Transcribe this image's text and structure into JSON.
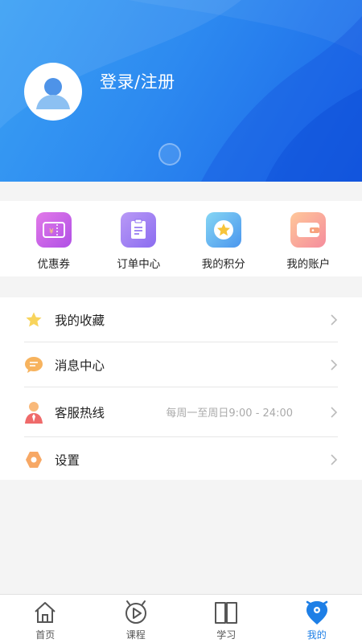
{
  "header": {
    "login_label": "登录/注册"
  },
  "quick_actions": [
    {
      "label": "优惠券",
      "icon": "coupon-icon"
    },
    {
      "label": "订单中心",
      "icon": "order-icon"
    },
    {
      "label": "我的积分",
      "icon": "star-points-icon"
    },
    {
      "label": "我的账户",
      "icon": "wallet-icon"
    }
  ],
  "menu": [
    {
      "label": "我的收藏",
      "icon": "star-icon"
    },
    {
      "label": "消息中心",
      "icon": "message-icon"
    },
    {
      "label": "客服热线",
      "icon": "customer-service-icon",
      "subtext": "每周一至周日9:00 - 24:00"
    },
    {
      "label": "设置",
      "icon": "settings-icon"
    }
  ],
  "tabbar": [
    {
      "label": "首页",
      "icon": "home-icon"
    },
    {
      "label": "课程",
      "icon": "play-icon"
    },
    {
      "label": "学习",
      "icon": "book-icon"
    },
    {
      "label": "我的",
      "icon": "profile-icon",
      "active": true
    }
  ],
  "colors": {
    "header_start": "#3aa0f4",
    "header_end": "#1a66e8",
    "tab_active": "#1e7fe6"
  }
}
